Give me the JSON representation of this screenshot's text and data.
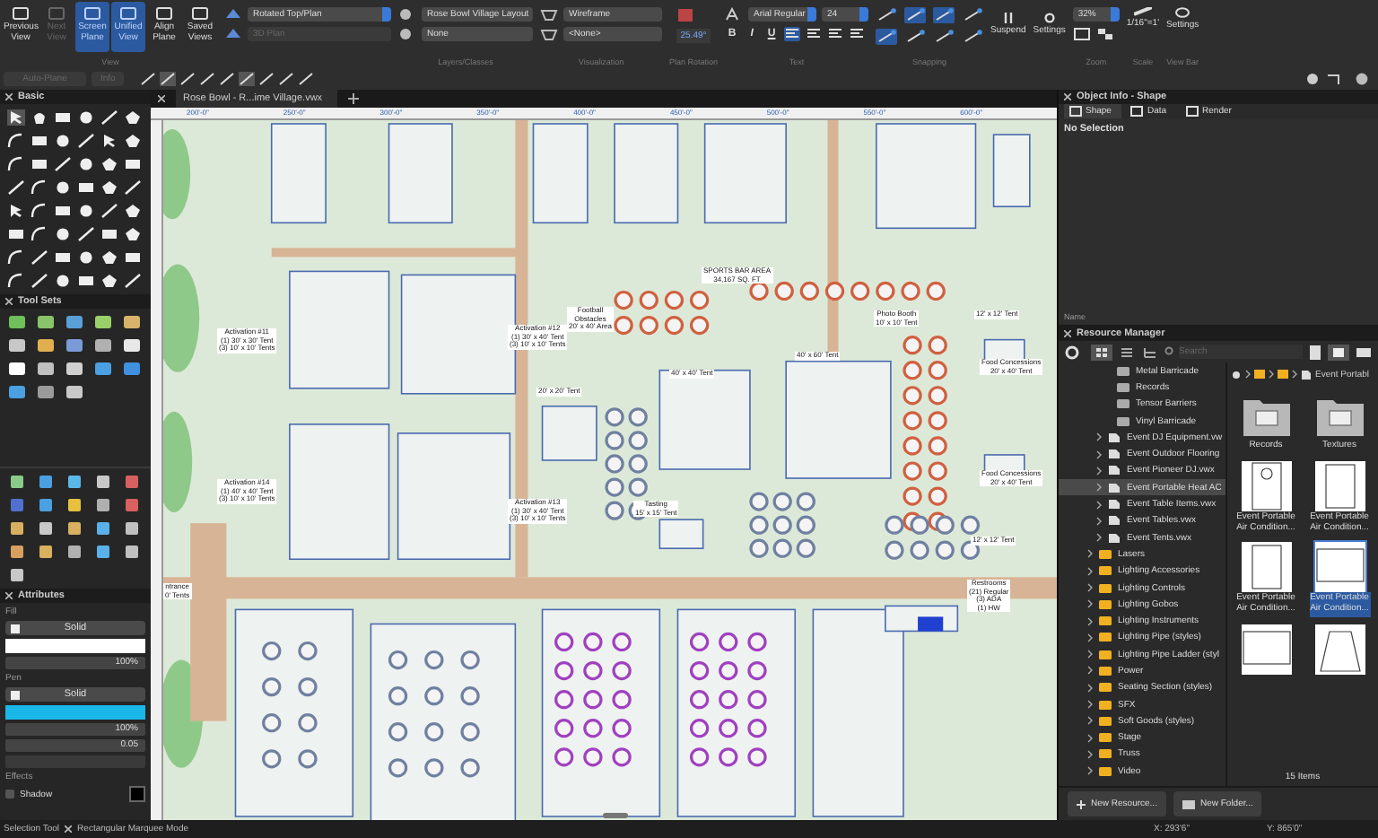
{
  "toolbar": {
    "view_buttons": [
      {
        "label": "Previous View",
        "selected": false,
        "disabled": false
      },
      {
        "label": "Next View",
        "selected": false,
        "disabled": true
      },
      {
        "label": "Screen Plane",
        "selected": true,
        "disabled": false
      },
      {
        "label": "Unified View",
        "selected": true,
        "disabled": false
      },
      {
        "label": "Align Plane",
        "selected": false,
        "disabled": false
      },
      {
        "label": "Saved Views",
        "selected": false,
        "disabled": false
      }
    ],
    "view_label": "View",
    "plane_dropdowns": [
      {
        "value": "Rotated Top/Plan",
        "disabled": false
      },
      {
        "value": "3D Plan",
        "disabled": true
      }
    ],
    "layers_classes": {
      "dropdowns": [
        "Rose Bowl Village Layout",
        "None"
      ],
      "label": "Layers/Classes"
    },
    "visualization": {
      "dropdowns": [
        "Wireframe",
        "<None>"
      ],
      "label": "Visualization"
    },
    "plan_rotation": {
      "value": "25.49°",
      "label": "Plan Rotation"
    },
    "text": {
      "font": "Arial Regular",
      "size": "24",
      "styles": [
        "B",
        "I",
        "U"
      ],
      "alignments": [
        {
          "selected": true
        },
        {
          "selected": false
        },
        {
          "selected": false
        },
        {
          "selected": false
        }
      ],
      "label": "Text"
    },
    "snapping": {
      "label": "Snapping"
    },
    "suspend": "Suspend",
    "snap_settings": "Settings",
    "zoom": {
      "value": "32%",
      "label": "Zoom"
    },
    "scale": {
      "value": "1/16\"=1'",
      "label": "Scale"
    },
    "view_bar": {
      "button": "Settings",
      "label": "View Bar"
    },
    "auto_plane": {
      "label": "Auto-Plane",
      "disabled": true
    },
    "info_button": {
      "label": "Info",
      "disabled": true
    }
  },
  "palettes": {
    "basic": "Basic",
    "tool_sets": "Tool Sets"
  },
  "attributes": {
    "title": "Attributes",
    "fill": {
      "label": "Fill",
      "style": "Solid",
      "opacity": "100%"
    },
    "pen": {
      "label": "Pen",
      "style": "Solid",
      "opacity": "100%",
      "thickness": "0.05"
    },
    "effects": {
      "label": "Effects",
      "shadow": {
        "label": "Shadow",
        "checked": false
      }
    }
  },
  "document_tab": {
    "title": "Rose Bowl - R...ime Village.vwx"
  },
  "ruler_ticks": [
    "200'-0\"",
    "250'-0\"",
    "300'-0\"",
    "350'-0\"",
    "400'-0\"",
    "450'-0\"",
    "500'-0\"",
    "550'-0\"",
    "600'-0\""
  ],
  "drawing_labels": [
    "SPORTS BAR AREA\n34,167 SQ. FT",
    "Football\nObstacles\n20' x 40' Area",
    "Photo Booth\n10' x 10' Tent",
    "Activation #11\n(1) 30' x 30' Tent\n(3) 10' x 10' Tents",
    "Activation #12\n(1) 30' x 40' Tent\n(3) 10' x 10' Tents",
    "12' x 12' Tent",
    "20' x 20' Tent",
    "40' x 40' Tent",
    "40' x 60' Tent",
    "Food Concessions\n20' x 40' Tent",
    "Activation #14\n(1) 40' x 40' Tent\n(3) 10' x 10' Tents",
    "Activation #13\n(1) 30' x 40' Tent\n(3) 10' x 10' Tents",
    "Food Concessions\n20' x 40' Tent",
    "12' x 12' Tent",
    "Tasting\n15' x 15' Tent",
    "Restrooms\n(21) Regular\n(3) ADA\n(1) HW",
    "ntrance\n0' Tents"
  ],
  "object_info": {
    "title": "Object Info - Shape",
    "tabs": [
      {
        "label": "Shape",
        "selected": true
      },
      {
        "label": "Data",
        "selected": false
      },
      {
        "label": "Render",
        "selected": false
      }
    ],
    "message": "No Selection",
    "footer": "Name"
  },
  "resource_manager": {
    "title": "Resource Manager",
    "search_placeholder": "Search",
    "breadcrumb": "Event Portabl",
    "tree": [
      {
        "label": "Metal Barricade",
        "kind": "subfolder",
        "selected": false
      },
      {
        "label": "Records",
        "kind": "subfolder",
        "selected": false
      },
      {
        "label": "Tensor Barriers",
        "kind": "subfolder",
        "selected": false
      },
      {
        "label": "Vinyl Barricade",
        "kind": "subfolder",
        "selected": false
      },
      {
        "label": "Event DJ Equipment.vw",
        "kind": "file",
        "selected": false
      },
      {
        "label": "Event Outdoor Flooring",
        "kind": "file",
        "selected": false
      },
      {
        "label": "Event Pioneer DJ.vwx",
        "kind": "file",
        "selected": false
      },
      {
        "label": "Event Portable Heat AC",
        "kind": "file",
        "selected": true
      },
      {
        "label": "Event Table Items.vwx",
        "kind": "file",
        "selected": false
      },
      {
        "label": "Event Tables.vwx",
        "kind": "file",
        "selected": false
      },
      {
        "label": "Event Tents.vwx",
        "kind": "file",
        "selected": false
      },
      {
        "label": "Lasers",
        "kind": "folder",
        "selected": false
      },
      {
        "label": "Lighting Accessories",
        "kind": "folder",
        "selected": false
      },
      {
        "label": "Lighting Controls",
        "kind": "folder",
        "selected": false
      },
      {
        "label": "Lighting Gobos",
        "kind": "folder",
        "selected": false
      },
      {
        "label": "Lighting Instruments",
        "kind": "folder",
        "selected": false
      },
      {
        "label": "Lighting Pipe (styles)",
        "kind": "folder",
        "selected": false
      },
      {
        "label": "Lighting Pipe Ladder (styl",
        "kind": "folder",
        "selected": false
      },
      {
        "label": "Power",
        "kind": "folder",
        "selected": false
      },
      {
        "label": "Seating Section (styles)",
        "kind": "folder",
        "selected": false
      },
      {
        "label": "SFX",
        "kind": "folder",
        "selected": false
      },
      {
        "label": "Soft Goods (styles)",
        "kind": "folder",
        "selected": false
      },
      {
        "label": "Stage",
        "kind": "folder",
        "selected": false
      },
      {
        "label": "Truss",
        "kind": "folder",
        "selected": false
      },
      {
        "label": "Video",
        "kind": "folder",
        "selected": false
      }
    ],
    "items": [
      {
        "label": "Records",
        "kind": "folder",
        "selected": false
      },
      {
        "label": "Textures",
        "kind": "folder",
        "selected": false
      },
      {
        "label": "Event Portable Air Condition...",
        "kind": "unit",
        "selected": false
      },
      {
        "label": "Event Portable Air Condition...",
        "kind": "panel",
        "selected": false
      },
      {
        "label": "Event Portable Air Condition...",
        "kind": "panel",
        "selected": false
      },
      {
        "label": "Event Portable Air Condition...",
        "kind": "wide",
        "selected": true
      },
      {
        "kind": "wide",
        "selected": false
      },
      {
        "kind": "trapezoid",
        "selected": false
      }
    ],
    "count": "15 Items",
    "buttons": [
      "New Resource...",
      "New Folder..."
    ]
  },
  "status_bar": {
    "tool": "Selection Tool",
    "mode": "Rectangular Marquee Mode",
    "x": "X: 293'6\"",
    "y": "Y: 865'0\""
  }
}
